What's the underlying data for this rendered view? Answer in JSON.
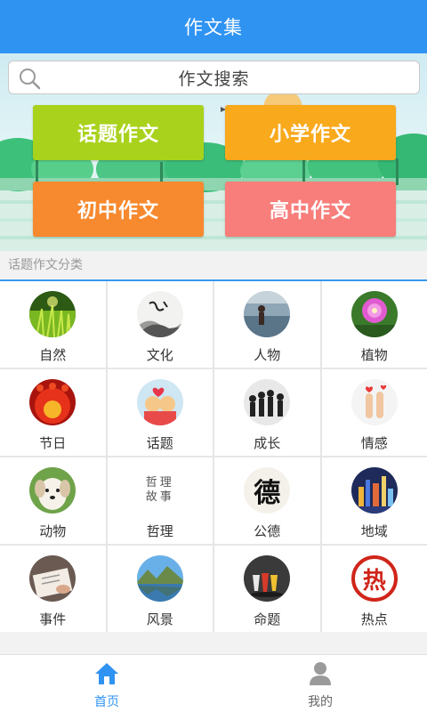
{
  "header": {
    "title": "作文集"
  },
  "search": {
    "placeholder": "作文搜索"
  },
  "categories": [
    {
      "label": "话题作文",
      "color": "#a9d21c"
    },
    {
      "label": "小学作文",
      "color": "#f9a91c"
    },
    {
      "label": "初中作文",
      "color": "#f7892e"
    },
    {
      "label": "高中作文",
      "color": "#f77e7a"
    }
  ],
  "section": {
    "label": "话题作文分类"
  },
  "topics": [
    {
      "label": "自然",
      "icon": "nature-icon"
    },
    {
      "label": "文化",
      "icon": "culture-icon"
    },
    {
      "label": "人物",
      "icon": "people-icon"
    },
    {
      "label": "植物",
      "icon": "plant-icon"
    },
    {
      "label": "节日",
      "icon": "festival-icon"
    },
    {
      "label": "话题",
      "icon": "topic-icon"
    },
    {
      "label": "成长",
      "icon": "growth-icon"
    },
    {
      "label": "情感",
      "icon": "emotion-icon"
    },
    {
      "label": "动物",
      "icon": "animal-icon"
    },
    {
      "label": "哲理",
      "icon": "philosophy-icon",
      "icon_text": [
        "哲理",
        "故事"
      ]
    },
    {
      "label": "公德",
      "icon": "morality-icon",
      "icon_text": [
        "德"
      ]
    },
    {
      "label": "地域",
      "icon": "region-icon"
    },
    {
      "label": "事件",
      "icon": "event-icon"
    },
    {
      "label": "风景",
      "icon": "scenery-icon"
    },
    {
      "label": "命题",
      "icon": "proposition-icon"
    },
    {
      "label": "热点",
      "icon": "hot-icon",
      "icon_text": [
        "热"
      ]
    }
  ],
  "tabs": [
    {
      "label": "首页",
      "icon": "home-icon",
      "active": true
    },
    {
      "label": "我的",
      "icon": "user-icon",
      "active": false
    }
  ],
  "colors": {
    "header": "#2f93f2",
    "accent": "#2f93f2",
    "section_line": "#3a99ee"
  }
}
